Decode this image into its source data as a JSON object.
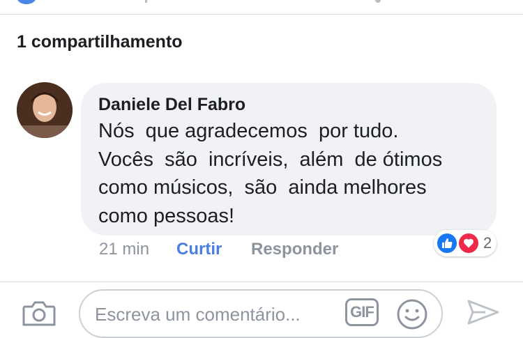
{
  "shares": {
    "label": "1 compartilhamento"
  },
  "comment": {
    "author": "Daniele Del Fabro",
    "text_lines": [
      "Nós  que agradecemos  por tudo.",
      "Vocês  são  incríveis,  além  de ótimos",
      "como músicos,  são  ainda melhores",
      "como pessoas!"
    ],
    "time": "21 min",
    "like_label": "Curtir",
    "reply_label": "Responder",
    "reactions": {
      "types": [
        "like-icon",
        "love-icon"
      ],
      "count": "2"
    }
  },
  "composer": {
    "placeholder": "Escreva um comentário...",
    "gif_label": "GIF",
    "icons": [
      "camera-icon",
      "gif-icon",
      "emoji-icon",
      "send-icon"
    ]
  },
  "colors": {
    "link_blue": "#4a7fe2",
    "like_blue": "#1877f2",
    "love_red": "#f0284a",
    "bubble_bg": "#f0f2f5",
    "muted_text": "#8d949e"
  }
}
